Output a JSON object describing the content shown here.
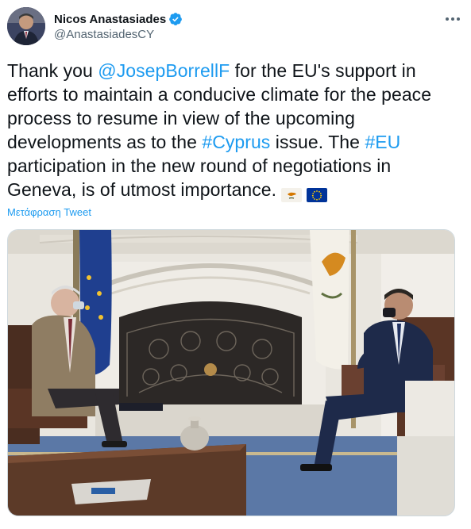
{
  "tweet": {
    "author": {
      "display_name": "Nicos Anastasiades",
      "handle": "@AnastasiadesCY",
      "verified": true
    },
    "text_segments": [
      {
        "text": "Thank you ",
        "type": "text"
      },
      {
        "text": "@JosepBorrellF",
        "type": "mention"
      },
      {
        "text": " for the EU's support in efforts to maintain a conducive climate for the peace process to resume in view of the upcoming developments as to the ",
        "type": "text"
      },
      {
        "text": "#Cyprus",
        "type": "hashtag"
      },
      {
        "text": " issue. The ",
        "type": "text"
      },
      {
        "text": "#EU",
        "type": "hashtag"
      },
      {
        "text": " participation in the new round of negotiations in Geneva, is of utmost importance.",
        "type": "text"
      }
    ],
    "emoji_flags": [
      "cyprus-flag",
      "eu-flag"
    ],
    "translate_label": "Μετάφραση Tweet",
    "colors": {
      "link": "#1d9bf0",
      "text": "#0f1419",
      "secondary": "#536471",
      "verified": "#1d9bf0"
    }
  }
}
